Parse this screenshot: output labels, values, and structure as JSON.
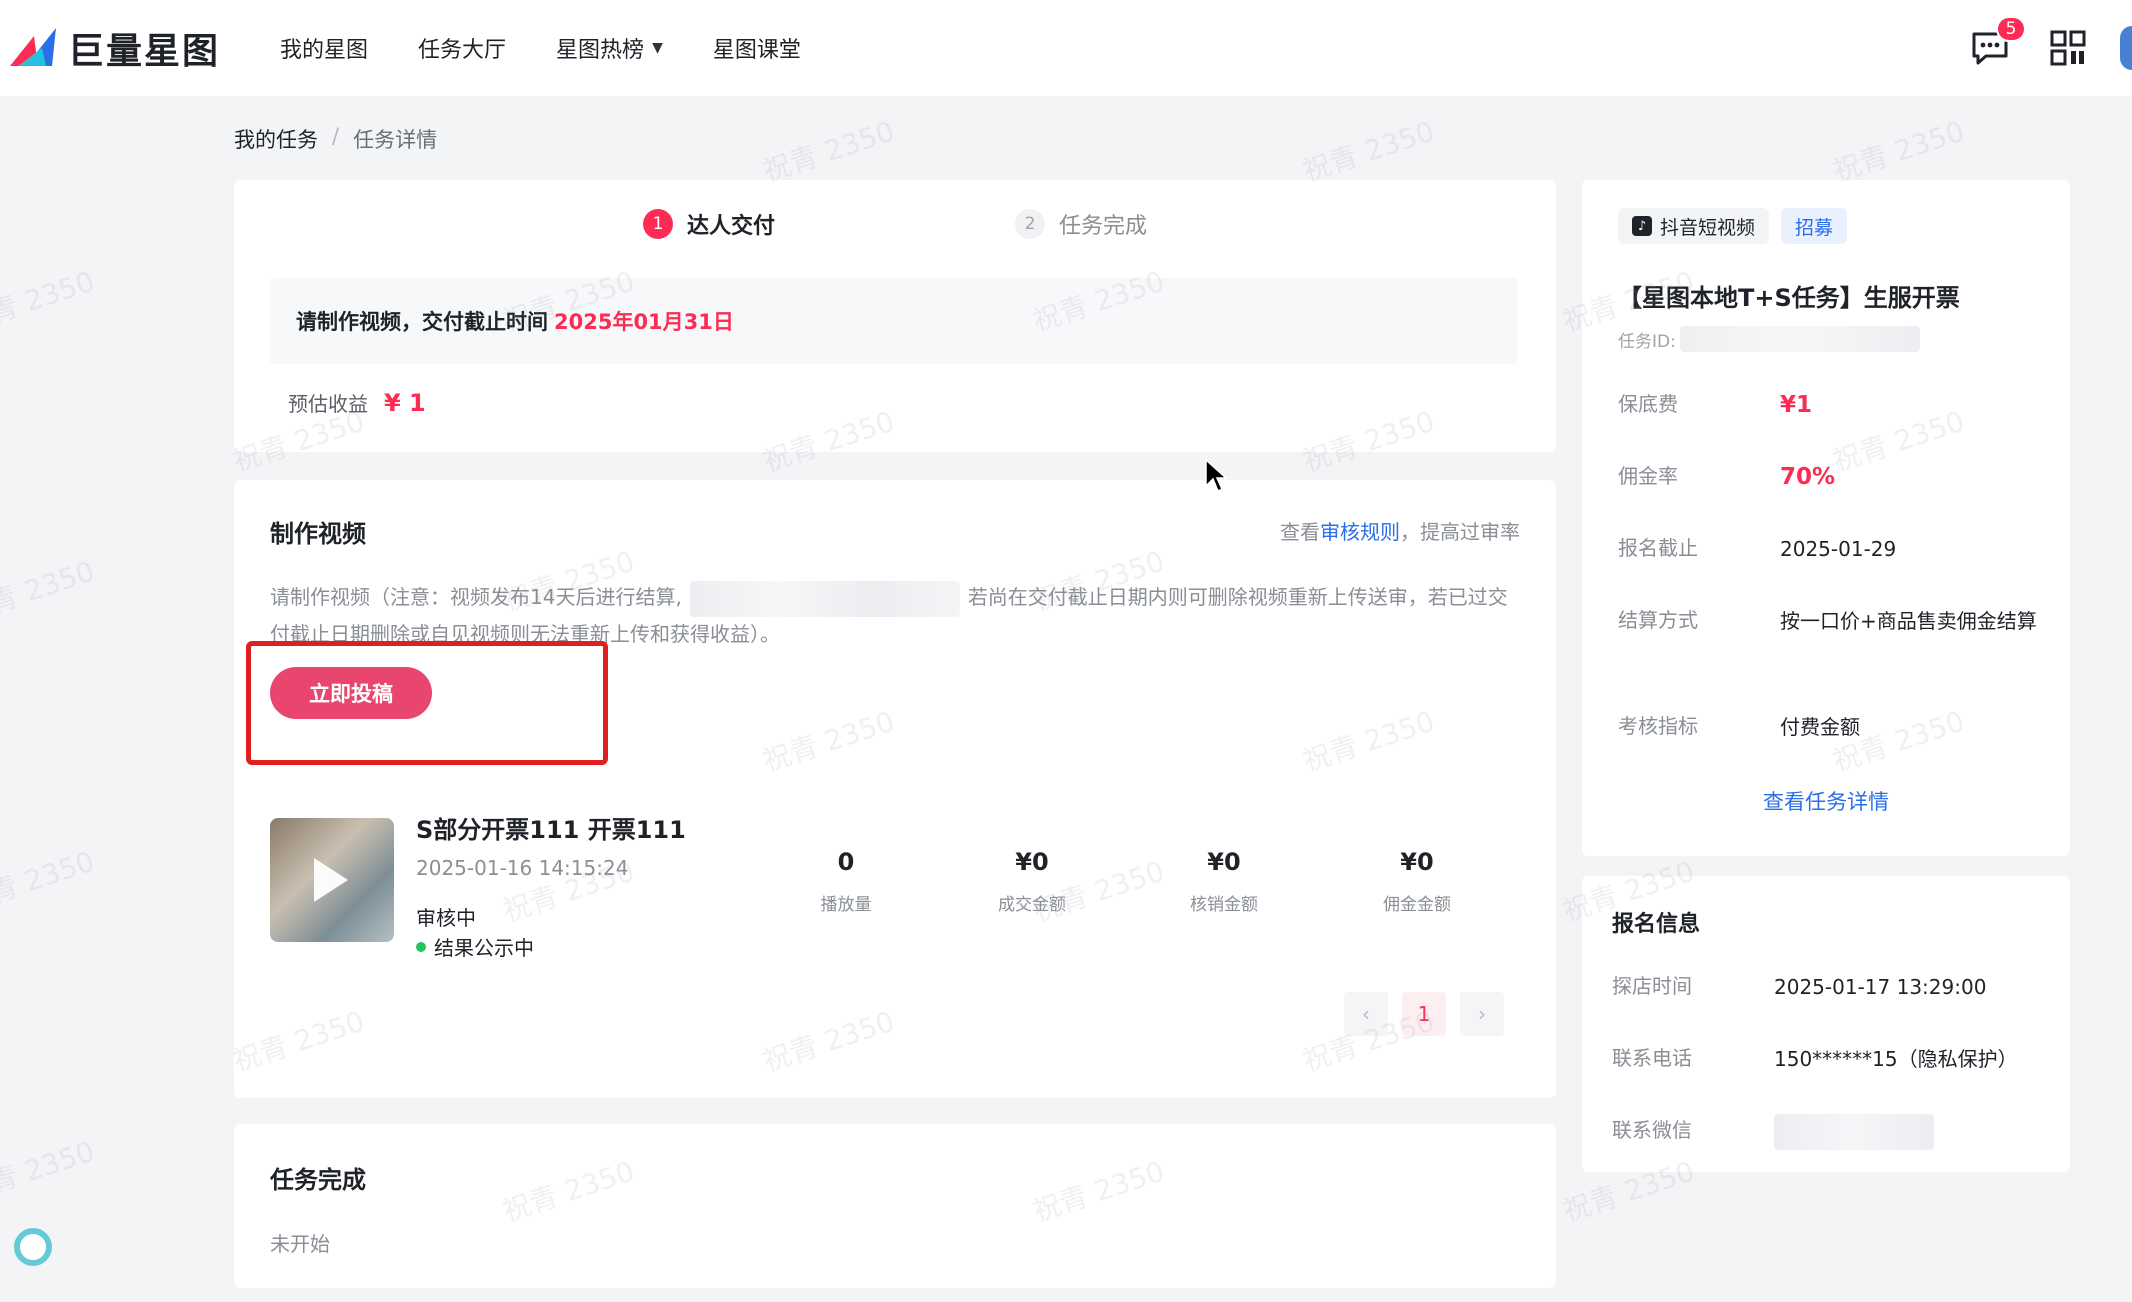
{
  "app": {
    "brand": "巨量星图",
    "nav": [
      "我的星图",
      "任务大厅",
      "星图热榜",
      "星图课堂"
    ],
    "message_badge": "5"
  },
  "breadcrumb": {
    "item1": "我的任务",
    "separator": "/",
    "item2": "任务详情"
  },
  "steps": [
    {
      "num": "1",
      "label": "达人交付"
    },
    {
      "num": "2",
      "label": "任务完成"
    }
  ],
  "delivery": {
    "deadline_text": "请制作视频，交付截止时间",
    "deadline_date": "2025年01月31日",
    "earning_label": "预估收益",
    "earning_value": "¥ 1"
  },
  "make_video": {
    "title": "制作视频",
    "rule_prefix": "查看",
    "rule_link": "审核规则",
    "rule_suffix": "，提高过审率",
    "note_part1": "请制作视频（注意：视频发布14天后进行结算,",
    "note_part2": "若尚在交付截止日期内则可删除视频重新上传送审，若已过交付截止日期删除或自见视频则无法重新上传和获得收益）。",
    "submit_button": "立即投稿"
  },
  "video": {
    "title": "S部分开票111 开票111",
    "datetime": "2025-01-16 14:15:24",
    "status": "审核中",
    "public_status": "结果公示中",
    "stats": [
      {
        "value": "0",
        "label": "播放量"
      },
      {
        "value": "¥0",
        "label": "成交金额"
      },
      {
        "value": "¥0",
        "label": "核销金额"
      },
      {
        "value": "¥0",
        "label": "佣金金额"
      }
    ]
  },
  "pagination": {
    "prev": "‹",
    "current": "1",
    "next": "›"
  },
  "task_complete": {
    "title": "任务完成",
    "status": "未开始"
  },
  "task_info": {
    "platform": "抖音短视频",
    "tag": "招募",
    "title": "【星图本地T+S任务】生服开票",
    "id_label": "任务ID:",
    "rows": [
      {
        "label": "保底费",
        "value": "¥1"
      },
      {
        "label": "佣金率",
        "value": "70%"
      },
      {
        "label": "报名截止",
        "value": "2025-01-29"
      },
      {
        "label": "结算方式",
        "value": "按一口价+商品售卖佣金结算"
      },
      {
        "label": "考核指标",
        "value": "付费金额"
      }
    ],
    "view_detail": "查看任务详情"
  },
  "signup": {
    "title": "报名信息",
    "rows": [
      {
        "label": "探店时间",
        "value": "2025-01-17 13:29:00"
      },
      {
        "label": "联系电话",
        "value": "150******15（隐私保护）"
      },
      {
        "label": "联系微信",
        "value": ""
      }
    ]
  },
  "watermark_text": "祝青 2350",
  "colors": {
    "accent": "#fe2c55",
    "link": "#2a6fe8",
    "highlight": "#e02020"
  }
}
